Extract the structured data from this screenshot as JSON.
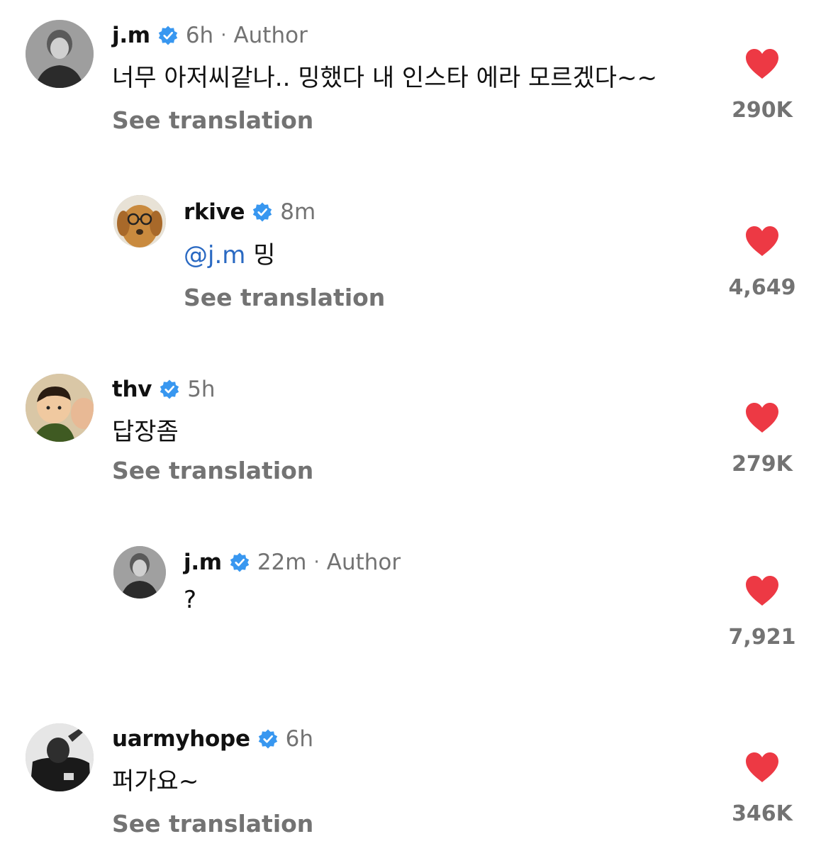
{
  "colors": {
    "heart": "#ed3944",
    "verified": "#3897f0",
    "secondary_text": "#737373",
    "mention": "#2a69c2"
  },
  "icons": {
    "verified": "verified-badge-icon",
    "like": "heart-filled-icon"
  },
  "comments": [
    {
      "username": "j.m",
      "time": "6h",
      "author_label": "Author",
      "text": "너무 아저씨같나.. 밍했다 내 인스타 에라 모르겠다~~",
      "translate_label": "See translation",
      "likes": "290K"
    },
    {
      "username": "rkive",
      "time": "8m",
      "mention": "@j.m",
      "text": "밍",
      "translate_label": "See translation",
      "likes": "4,649"
    },
    {
      "username": "thv",
      "time": "5h",
      "text": "답장좀",
      "translate_label": "See translation",
      "likes": "279K"
    },
    {
      "username": "j.m",
      "time": "22m",
      "author_label": "Author",
      "text": "?",
      "likes": "7,921"
    },
    {
      "username": "uarmyhope",
      "time": "6h",
      "text": "퍼가요~",
      "translate_label": "See translation",
      "likes": "346K"
    }
  ]
}
